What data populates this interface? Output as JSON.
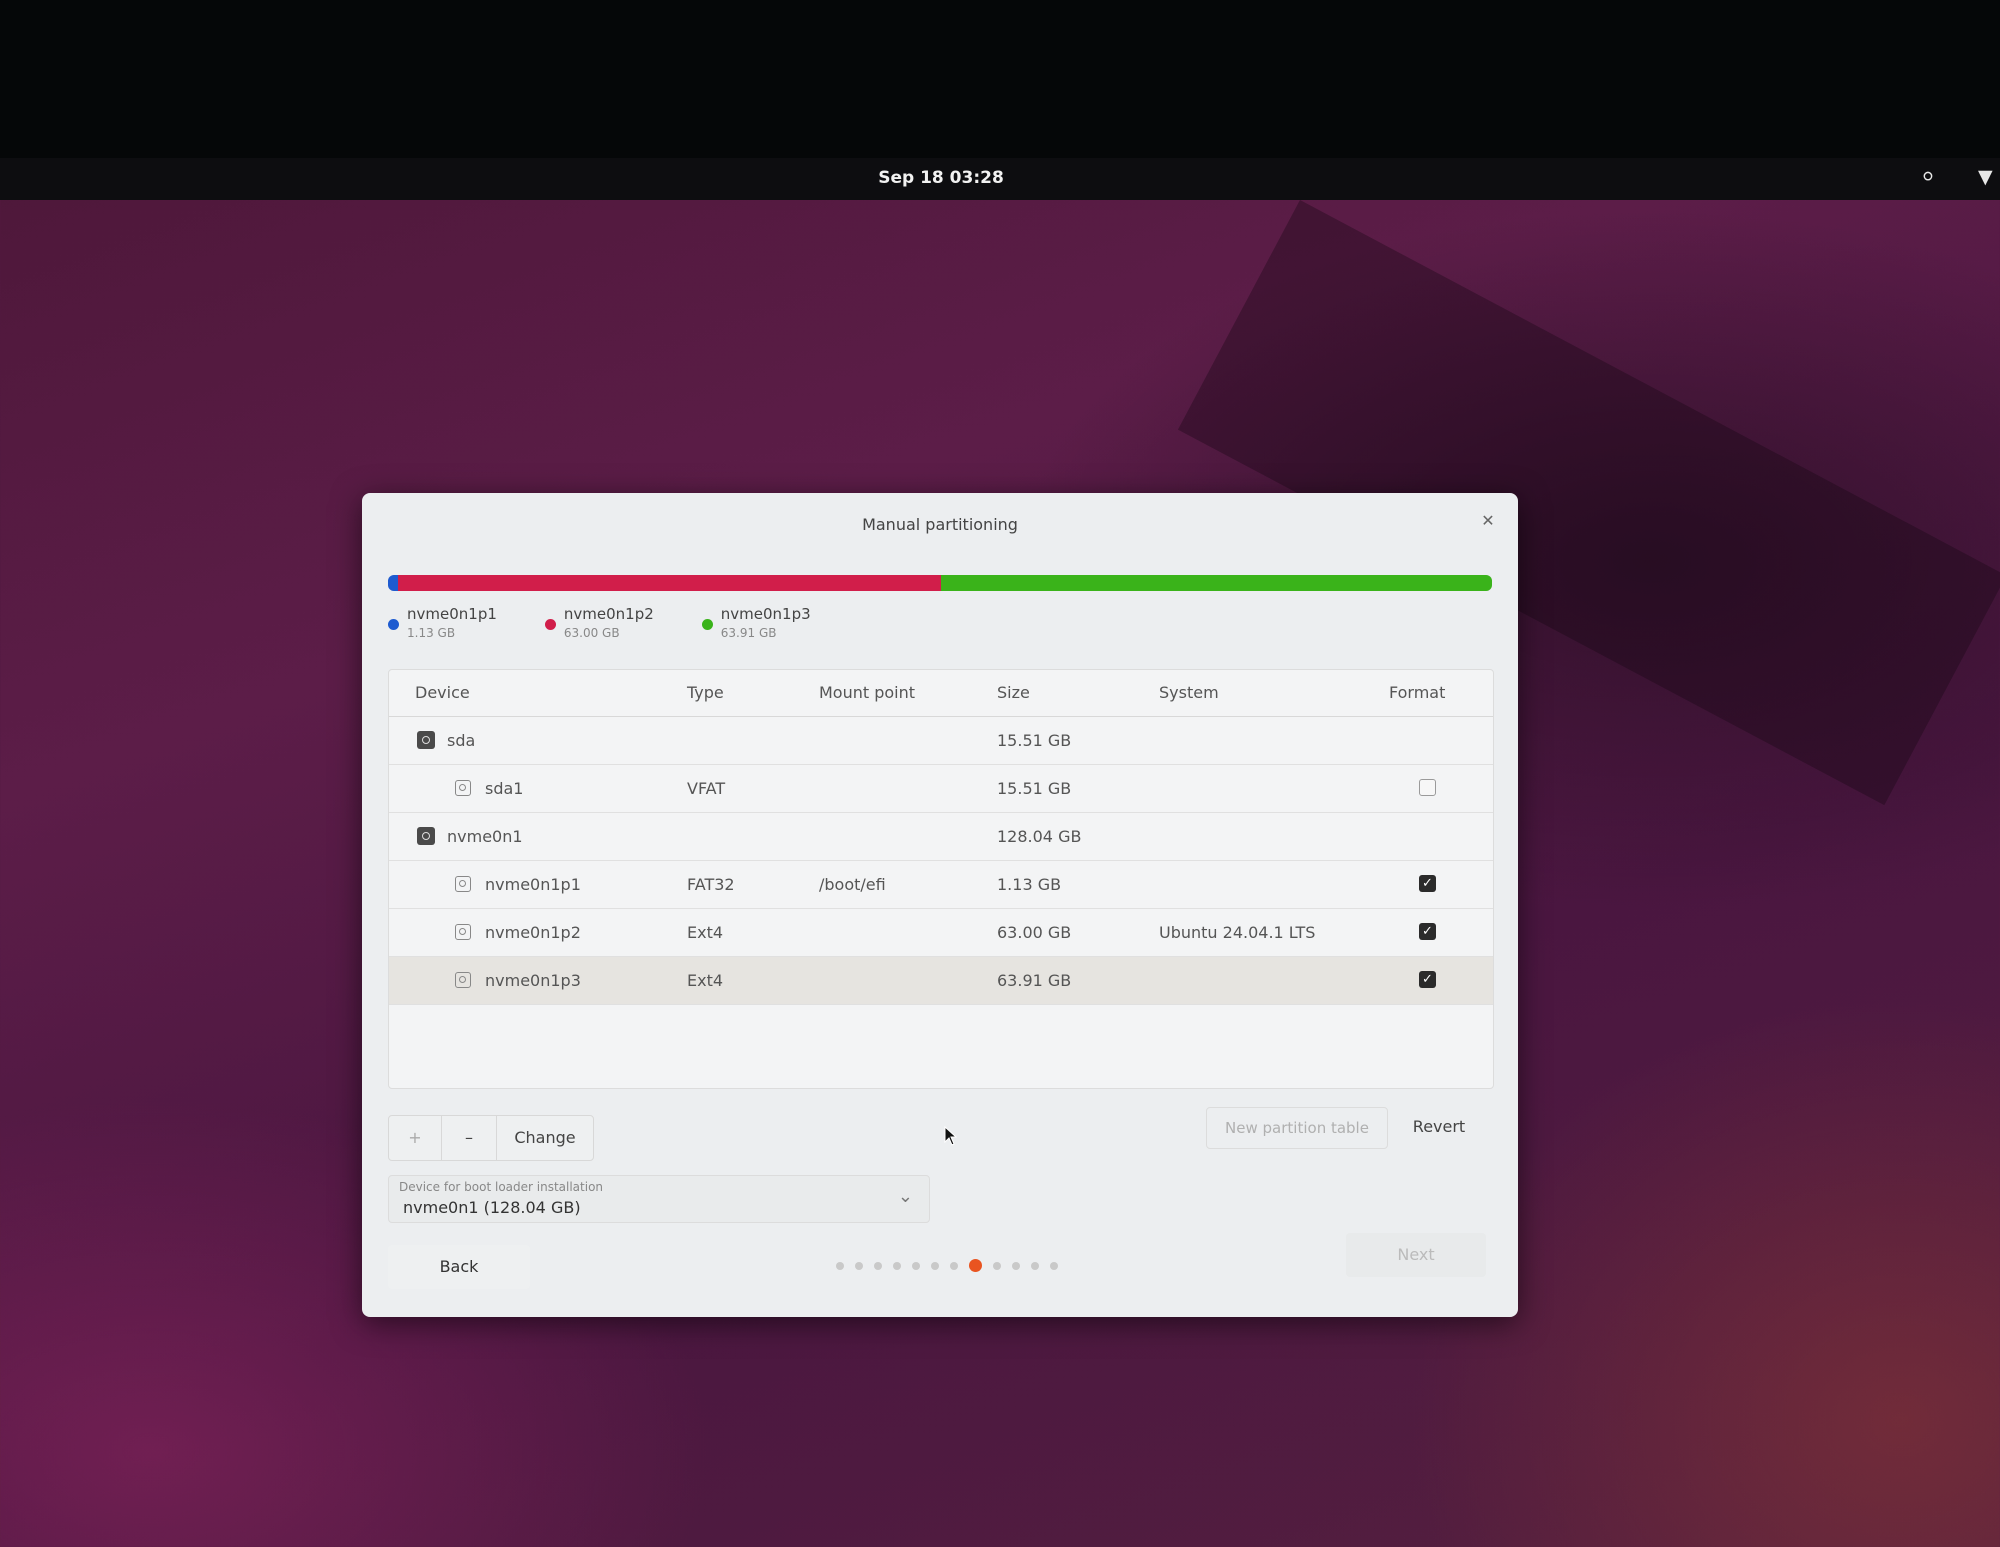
{
  "topbar": {
    "clock": "Sep 18  03:28",
    "accessibility_icon": "accessibility-icon",
    "network_icon": "wifi-icon"
  },
  "dialog": {
    "title": "Manual partitioning",
    "close_icon": "close-icon"
  },
  "usage": {
    "segments": [
      {
        "name": "nvme0n1p1",
        "size": "1.13 GB",
        "gb": 1.13,
        "color": "#1e5bd0"
      },
      {
        "name": "nvme0n1p2",
        "size": "63.00 GB",
        "gb": 63.0,
        "color": "#d11e4a"
      },
      {
        "name": "nvme0n1p3",
        "size": "63.91 GB",
        "gb": 63.91,
        "color": "#3ab31a"
      }
    ]
  },
  "table": {
    "headers": {
      "device": "Device",
      "type": "Type",
      "mount": "Mount point",
      "size": "Size",
      "system": "System",
      "format": "Format"
    },
    "rows": [
      {
        "device": "sda",
        "type": "",
        "mount": "",
        "size": "15.51 GB",
        "system": "",
        "format": null,
        "kind": "disk"
      },
      {
        "device": "sda1",
        "type": "VFAT",
        "mount": "",
        "size": "15.51 GB",
        "system": "",
        "format": false,
        "kind": "partition"
      },
      {
        "device": "nvme0n1",
        "type": "",
        "mount": "",
        "size": "128.04 GB",
        "system": "",
        "format": null,
        "kind": "disk"
      },
      {
        "device": "nvme0n1p1",
        "type": "FAT32",
        "mount": "/boot/efi",
        "size": "1.13 GB",
        "system": "",
        "format": true,
        "kind": "partition"
      },
      {
        "device": "nvme0n1p2",
        "type": "Ext4",
        "mount": "",
        "size": "63.00 GB",
        "system": "Ubuntu 24.04.1 LTS",
        "format": true,
        "kind": "partition"
      },
      {
        "device": "nvme0n1p3",
        "type": "Ext4",
        "mount": "",
        "size": "63.91 GB",
        "system": "",
        "format": true,
        "kind": "partition",
        "selected": true
      }
    ]
  },
  "toolbar": {
    "add_label": "+",
    "remove_label": "–",
    "change_label": "Change"
  },
  "actions": {
    "new_partition_table": "New partition table",
    "revert": "Revert"
  },
  "bootloader": {
    "label": "Device for boot loader installation",
    "value": "nvme0n1  (128.04 GB)"
  },
  "nav": {
    "back": "Back",
    "next": "Next",
    "steps_total": 12,
    "current_step": 8
  }
}
